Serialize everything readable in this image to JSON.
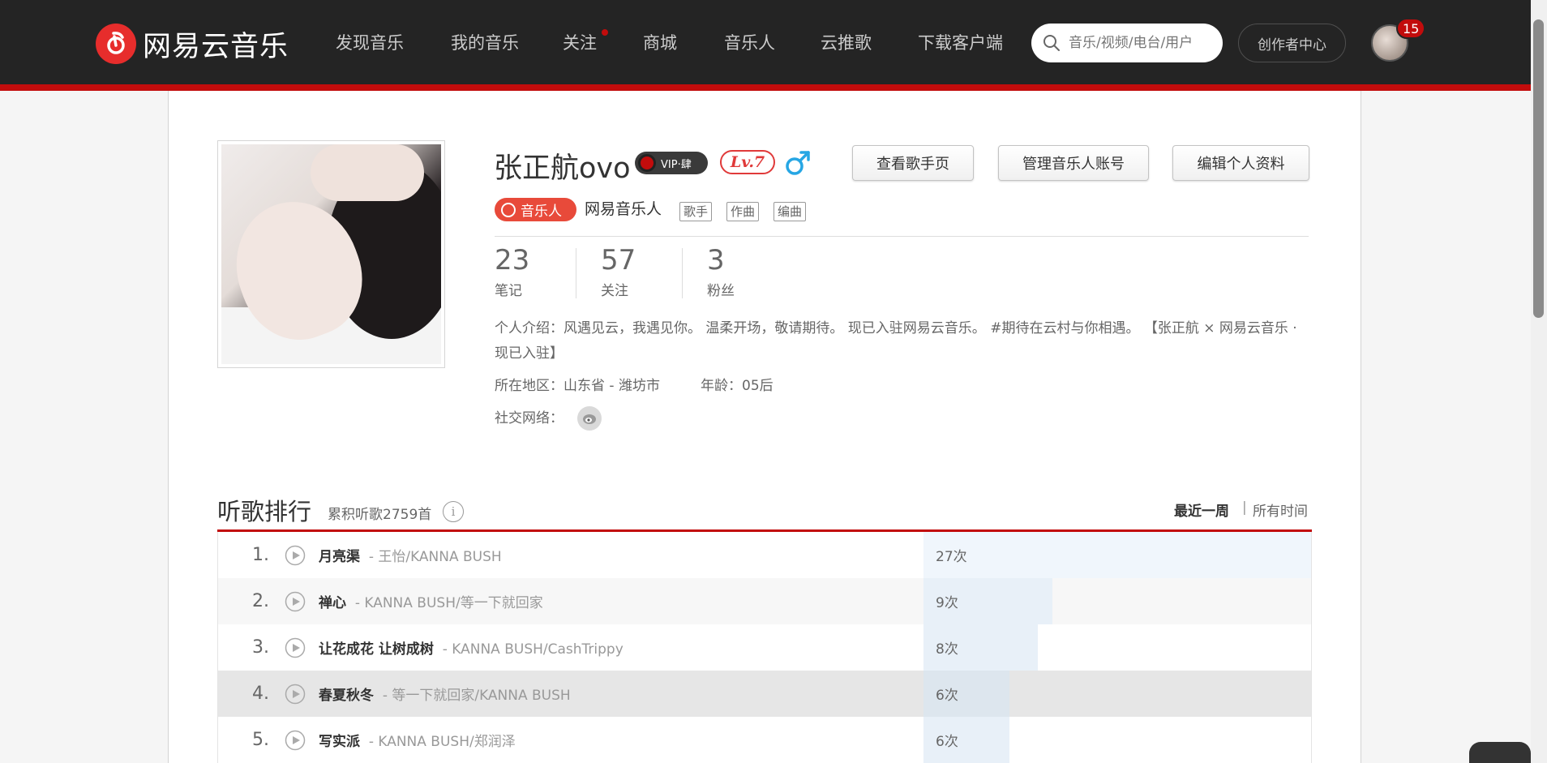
{
  "header": {
    "logo_text": "网易云音乐",
    "nav": [
      {
        "label": "发现音乐",
        "has_dot": false
      },
      {
        "label": "我的音乐",
        "has_dot": false
      },
      {
        "label": "关注",
        "has_dot": true
      },
      {
        "label": "商城",
        "has_dot": false
      },
      {
        "label": "音乐人",
        "has_dot": false
      },
      {
        "label": "云推歌",
        "has_dot": false
      },
      {
        "label": "下载客户端",
        "has_dot": false
      }
    ],
    "search_placeholder": "音乐/视频/电台/用户",
    "creator_center": "创作者中心",
    "notification_count": "15",
    "accent_color": "#c20c0c"
  },
  "profile": {
    "username": "张正航ovo",
    "vip_label": "VIP·肆",
    "level": "Lv.7",
    "gender_icon": "male-icon",
    "buttons": {
      "view_artist": "查看歌手页",
      "manage_account": "管理音乐人账号",
      "edit_profile": "编辑个人资料"
    },
    "role_tag": "音乐人",
    "role_text": "网易音乐人",
    "skills": [
      "歌手",
      "作曲",
      "编曲"
    ],
    "stats": [
      {
        "num": "23",
        "label": "笔记"
      },
      {
        "num": "57",
        "label": "关注"
      },
      {
        "num": "3",
        "label": "粉丝"
      }
    ],
    "intro": "个人介绍：风遇见云，我遇见你。 温柔开场，敬请期待。 现已入驻网易云音乐。 #期待在云村与你相遇。 【张正航 × 网易云音乐 · 现已入驻】",
    "location": "所在地区：山东省 - 潍坊市",
    "age": "年龄：05后",
    "social_label": "社交网络："
  },
  "ranking": {
    "title": "听歌排行",
    "subtitle": "累积听歌2759首",
    "period_week": "最近一周",
    "period_sep": "|",
    "period_all": "所有时间",
    "rows": [
      {
        "num": "1.",
        "name": "月亮渠",
        "artist": "- 王怡/KANNA BUSH",
        "count": "27次",
        "share": 1.0
      },
      {
        "num": "2.",
        "name": "禅心",
        "artist": "- KANNA BUSH/等一下就回家",
        "count": "9次",
        "share": 0.333
      },
      {
        "num": "3.",
        "name": "让花成花 让树成树",
        "artist": "- KANNA BUSH/CashTrippy",
        "count": "8次",
        "share": 0.296
      },
      {
        "num": "4.",
        "name": "春夏秋冬",
        "artist": "- 等一下就回家/KANNA BUSH",
        "count": "6次",
        "share": 0.222
      },
      {
        "num": "5.",
        "name": "写实派",
        "artist": "- KANNA BUSH/郑润泽",
        "count": "6次",
        "share": 0.222
      }
    ]
  }
}
